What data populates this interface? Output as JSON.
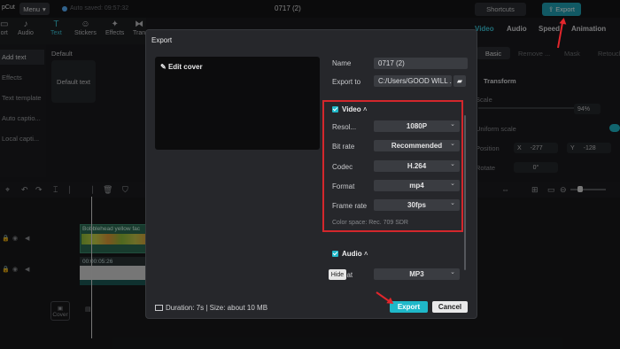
{
  "app": {
    "title": "pCut",
    "menu_label": "Menu",
    "autosave": "Auto saved: 09:57:32",
    "project_name": "0717 (2)",
    "shortcuts_label": "Shortcuts",
    "export_label": "Export"
  },
  "toolbar": {
    "items": [
      "ort",
      "Audio",
      "Text",
      "Stickers",
      "Effects",
      "Tran"
    ]
  },
  "sidebar": {
    "items": [
      "Add text",
      "Effects",
      "Text template",
      "Auto captio...",
      "Local capti..."
    ],
    "default_label": "Default",
    "default_card": "Default text"
  },
  "right_panel": {
    "tabs": [
      "Video",
      "Audio",
      "Speed",
      "Animation"
    ],
    "subtabs": [
      "Basic",
      "Remove ...",
      "Mask",
      "Retouch"
    ],
    "transform": "Transform",
    "scale_label": "Scale",
    "scale_value": "94%",
    "uniform_scale": "Uniform scale",
    "position_label": "Position",
    "pos_x_label": "X",
    "pos_x": "-277",
    "pos_y_label": "Y",
    "pos_y": "-128",
    "rotate_label": "Rotate",
    "rotate_value": "0°"
  },
  "timeline": {
    "video_clip_label": "Bobblehead yellow fac",
    "audio_clip_label": "00:00:05:26",
    "cover_label": "Cover"
  },
  "dialog": {
    "title": "Export",
    "edit_cover": "Edit cover",
    "name_label": "Name",
    "name_value": "0717 (2)",
    "export_to_label": "Export to",
    "export_to_value": "C:/Users/GOOD WILL ...",
    "video_section": "Video",
    "resolution_label": "Resol...",
    "resolution_value": "1080P",
    "bitrate_label": "Bit rate",
    "bitrate_value": "Recommended",
    "codec_label": "Codec",
    "codec_value": "H.264",
    "format_label": "Format",
    "format_value": "mp4",
    "framerate_label": "Frame rate",
    "framerate_value": "30fps",
    "color_space": "Color space: Rec. 709 SDR",
    "audio_section": "Audio",
    "audio_format_label": "nat",
    "audio_format_value": "MP3",
    "hide_tooltip": "Hide",
    "duration": "Duration: 7s | Size: about 10 MB",
    "export_button": "Export",
    "cancel_button": "Cancel"
  },
  "colors": {
    "accent": "#1fb8c9",
    "highlight_box": "#d3272c",
    "annotation_arrow": "#e2262c"
  }
}
